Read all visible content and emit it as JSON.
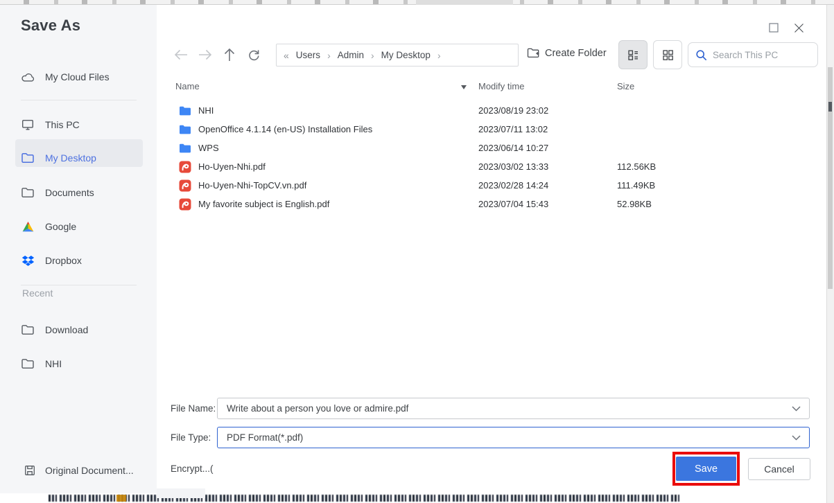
{
  "dialog": {
    "title": "Save As"
  },
  "sidebar": {
    "items": [
      {
        "label": "My Cloud Files"
      },
      {
        "label": "This PC"
      },
      {
        "label": "My Desktop"
      },
      {
        "label": "Documents"
      },
      {
        "label": "Google"
      },
      {
        "label": "Dropbox"
      }
    ],
    "recent_label": "Recent",
    "recent_items": [
      {
        "label": "Download"
      },
      {
        "label": "NHI"
      }
    ],
    "original_document_label": "Original Document..."
  },
  "toolbar": {
    "breadcrumb": {
      "collapse_glyph": "«",
      "separator": "›",
      "items": [
        "Users",
        "Admin",
        "My Desktop"
      ]
    },
    "create_folder_label": "Create Folder",
    "search_placeholder": "Search This PC"
  },
  "file_list": {
    "columns": {
      "name": "Name",
      "modified": "Modify time",
      "size": "Size"
    },
    "rows": [
      {
        "type": "folder",
        "name": "NHI",
        "modified": "2023/08/19 23:02",
        "size": ""
      },
      {
        "type": "folder",
        "name": "OpenOffice 4.1.14 (en-US) Installation Files",
        "modified": "2023/07/11 13:02",
        "size": ""
      },
      {
        "type": "folder",
        "name": "WPS",
        "modified": "2023/06/14 10:27",
        "size": ""
      },
      {
        "type": "pdf",
        "name": "Ho-Uyen-Nhi.pdf",
        "modified": "2023/03/02 13:33",
        "size": "112.56KB"
      },
      {
        "type": "pdf",
        "name": "Ho-Uyen-Nhi-TopCV.vn.pdf",
        "modified": "2023/02/28 14:24",
        "size": "111.49KB"
      },
      {
        "type": "pdf",
        "name": "My favorite subject is English.pdf",
        "modified": "2023/07/04 15:43",
        "size": "52.98KB"
      }
    ]
  },
  "footer": {
    "file_name_label": "File Name:",
    "file_name_value": "Write about a person you love or admire.pdf",
    "file_type_label": "File Type:",
    "file_type_value": "PDF Format(*.pdf)",
    "encrypt_label": "Encrypt...(",
    "save_label": "Save",
    "cancel_label": "Cancel"
  },
  "colors": {
    "accent_blue": "#4d71e0",
    "save_button_blue": "#3b76df",
    "annotation_red": "#ea0c0c",
    "folder_icon_blue": "#3e86f5",
    "pdf_icon_red": "#e74a3a",
    "dropbox_blue": "#0062ff",
    "sidebar_bg": "#f5f6f8",
    "selected_item_bg": "#e8eaee"
  }
}
